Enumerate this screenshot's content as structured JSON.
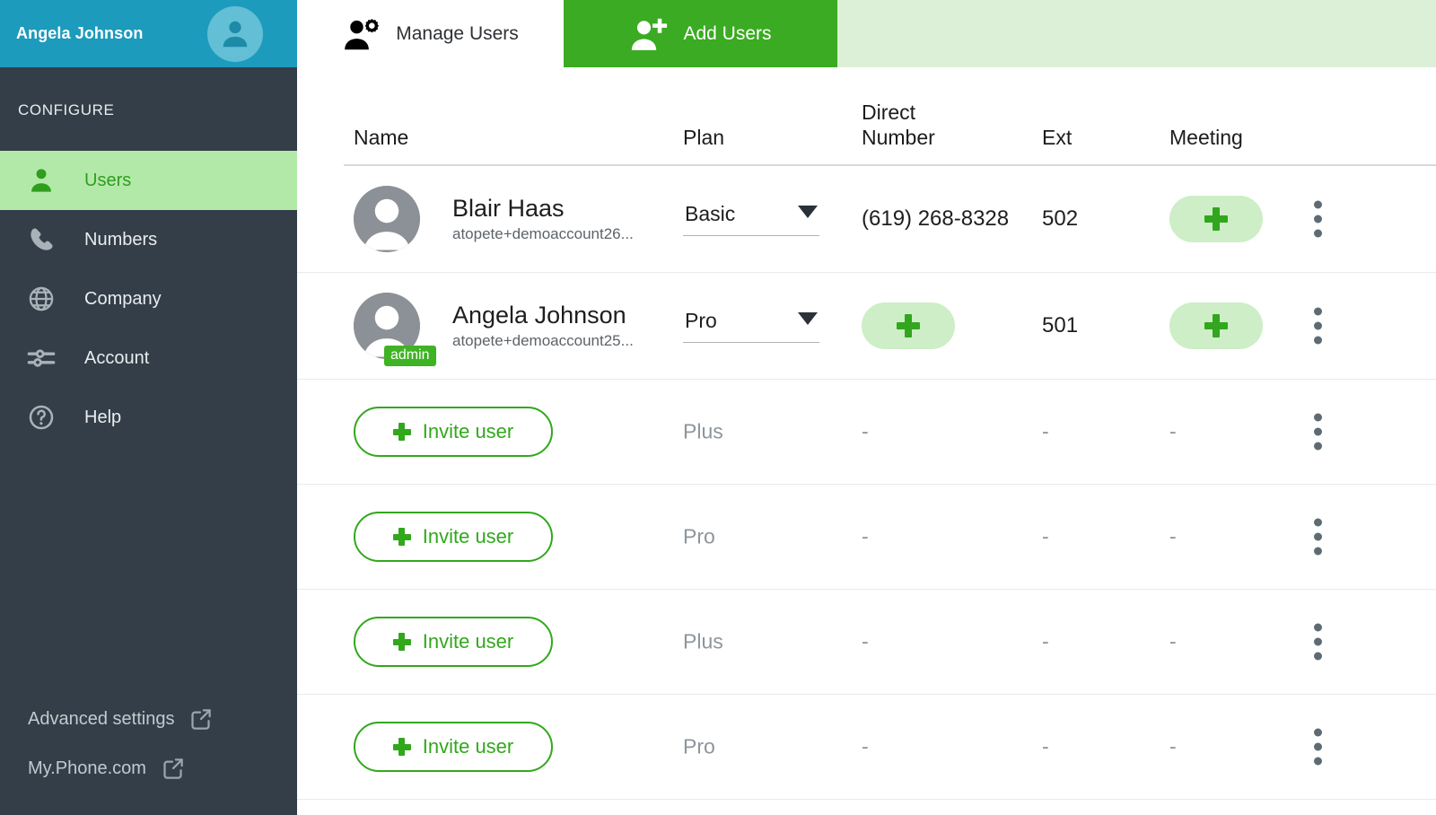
{
  "sidebar": {
    "account_name": "Angela Johnson",
    "avatar_icon": "user-avatar-icon",
    "section_label": "CONFIGURE",
    "items": [
      {
        "label": "Users",
        "icon": "user-icon",
        "active": true
      },
      {
        "label": "Numbers",
        "icon": "phone-icon",
        "active": false
      },
      {
        "label": "Company",
        "icon": "globe-icon",
        "active": false
      },
      {
        "label": "Account",
        "icon": "sliders-icon",
        "active": false
      },
      {
        "label": "Help",
        "icon": "question-circle-icon",
        "active": false
      }
    ],
    "bottom_links": [
      {
        "label": "Advanced settings",
        "icon": "external-link-icon"
      },
      {
        "label": "My.Phone.com",
        "icon": "external-link-icon"
      }
    ]
  },
  "tabs": [
    {
      "label": "Manage Users",
      "icon": "manage-users-icon",
      "active": false
    },
    {
      "label": "Add Users",
      "icon": "add-user-icon",
      "active": true
    }
  ],
  "table": {
    "headers": {
      "name": "Name",
      "plan": "Plan",
      "direct_number_line1": "Direct",
      "direct_number_line2": "Number",
      "ext": "Ext",
      "meeting": "Meeting"
    },
    "rows": [
      {
        "type": "user",
        "name": "Blair Haas",
        "email": "atopete+demoaccount26...",
        "badge": null,
        "plan": "Basic",
        "direct_number": "(619) 268-8328",
        "direct_number_is_add": false,
        "ext": "502",
        "meeting_is_add": true,
        "meeting": null
      },
      {
        "type": "user",
        "name": "Angela Johnson",
        "email": "atopete+demoaccount25...",
        "badge": "admin",
        "plan": "Pro",
        "direct_number": null,
        "direct_number_is_add": true,
        "ext": "501",
        "meeting_is_add": true,
        "meeting": null
      },
      {
        "type": "invite",
        "invite_label": "Invite user",
        "plan": "Plus",
        "direct_number": "-",
        "ext": "-",
        "meeting": "-"
      },
      {
        "type": "invite",
        "invite_label": "Invite user",
        "plan": "Pro",
        "direct_number": "-",
        "ext": "-",
        "meeting": "-"
      },
      {
        "type": "invite",
        "invite_label": "Invite user",
        "plan": "Plus",
        "direct_number": "-",
        "ext": "-",
        "meeting": "-"
      },
      {
        "type": "invite",
        "invite_label": "Invite user",
        "plan": "Pro",
        "direct_number": "-",
        "ext": "-",
        "meeting": "-"
      }
    ],
    "row_menu_icon": "kebab-menu-icon",
    "add_icon": "plus-icon"
  },
  "colors": {
    "header_teal": "#1d9bbd",
    "sidebar_dark": "#333e48",
    "active_green": "#b3e9a8",
    "tab_green": "#3aab22",
    "tab_band_green": "#dcf0d8",
    "badge_green": "#3fb324",
    "pill_green": "#cdeec6",
    "plus_green": "#32a61e"
  }
}
